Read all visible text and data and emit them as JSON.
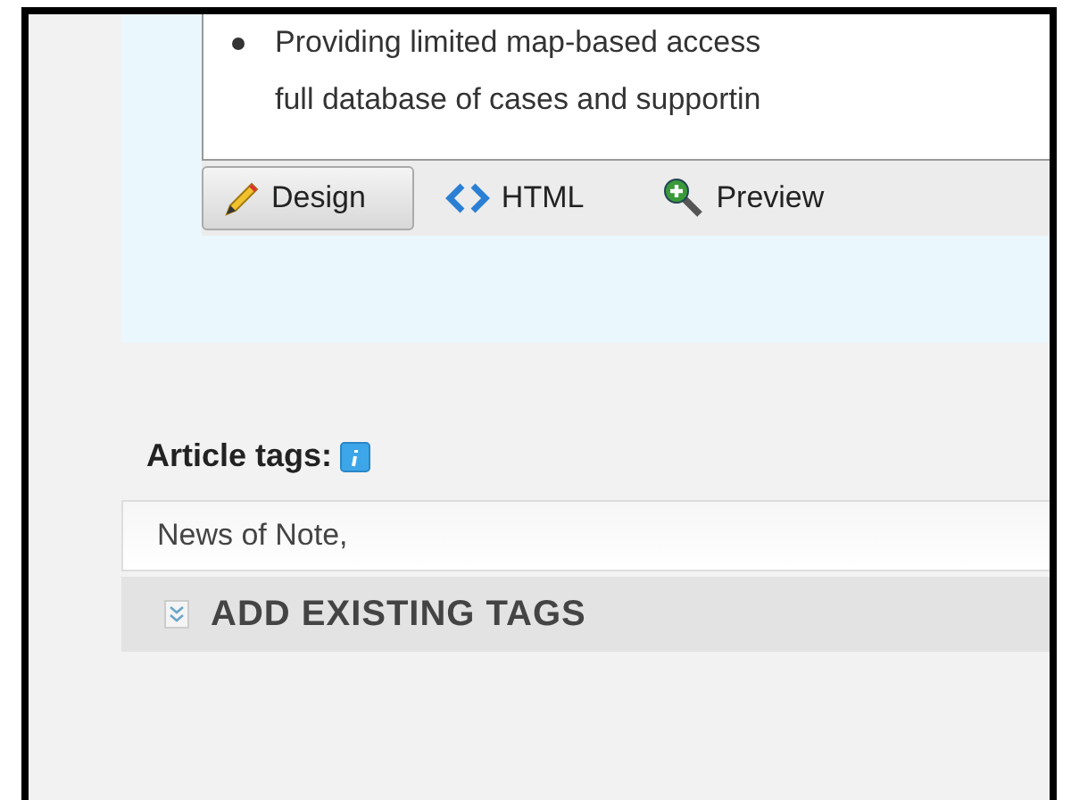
{
  "editor": {
    "bullets": [
      {
        "lines": [
          "Providing limited map-based access",
          "full database of cases and supportin"
        ]
      }
    ],
    "modes": [
      {
        "label": "Design",
        "kind": "design",
        "selected": true
      },
      {
        "label": "HTML",
        "kind": "html",
        "selected": false
      },
      {
        "label": "Preview",
        "kind": "preview",
        "selected": false
      }
    ]
  },
  "article_tags": {
    "label": "Article tags:",
    "value": "News of Note,",
    "add_existing": "ADD EXISTING TAGS"
  }
}
